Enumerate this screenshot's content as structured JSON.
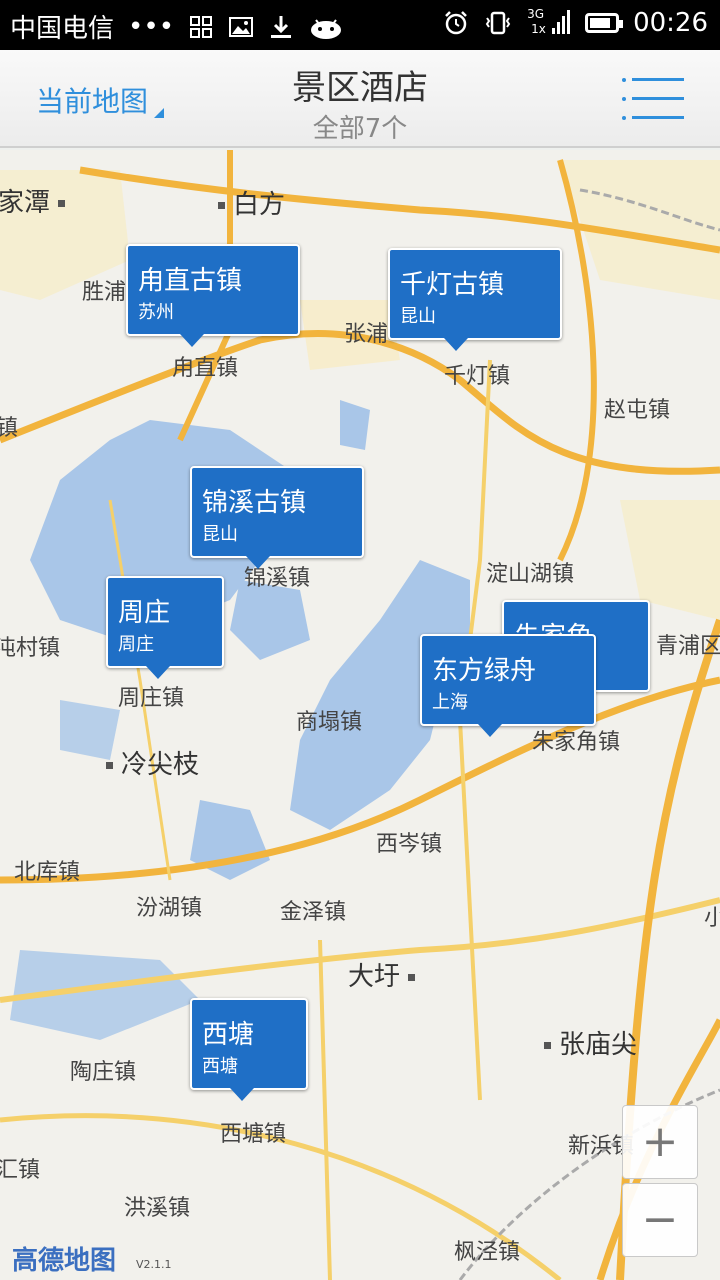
{
  "status_bar": {
    "carrier": "中国电信",
    "dots": "•••",
    "network": "3G",
    "network2": "1x",
    "time": "00:26"
  },
  "header": {
    "map_switch": "当前地图",
    "title": "景区酒店",
    "subtitle": "全部7个"
  },
  "map": {
    "places": [
      {
        "label": "家潭",
        "big": true
      },
      {
        "label": "白方",
        "big": true
      },
      {
        "label": "胜浦"
      },
      {
        "label": "张浦"
      },
      {
        "label": "甪直镇"
      },
      {
        "label": "千灯镇"
      },
      {
        "label": "赵屯镇"
      },
      {
        "label": "镇"
      },
      {
        "label": "锦溪镇"
      },
      {
        "label": "淀山湖镇"
      },
      {
        "label": "青浦区"
      },
      {
        "label": "沌村镇"
      },
      {
        "label": "周庄镇"
      },
      {
        "label": "商塌镇"
      },
      {
        "label": "朱家角镇"
      },
      {
        "label": "冷尖枝",
        "big": true
      },
      {
        "label": "西岑镇"
      },
      {
        "label": "北库镇"
      },
      {
        "label": "汾湖镇"
      },
      {
        "label": "金泽镇"
      },
      {
        "label": "小"
      },
      {
        "label": "大圩",
        "big": true
      },
      {
        "label": "张庙尖",
        "big": true
      },
      {
        "label": "陶庄镇"
      },
      {
        "label": "西塘镇"
      },
      {
        "label": "汇镇"
      },
      {
        "label": "新浜镇"
      },
      {
        "label": "洪溪镇"
      },
      {
        "label": "枫泾镇"
      }
    ],
    "markers": [
      {
        "name": "甪直古镇",
        "city": "苏州"
      },
      {
        "name": "千灯古镇",
        "city": "昆山"
      },
      {
        "name": "锦溪古镇",
        "city": "昆山"
      },
      {
        "name": "周庄",
        "city": "周庄"
      },
      {
        "name": "朱家角",
        "city": ""
      },
      {
        "name": "东方绿舟",
        "city": "上海"
      },
      {
        "name": "西塘",
        "city": "西塘"
      }
    ],
    "zoom_in": "+",
    "zoom_out": "−",
    "logo": "高德地图",
    "version": "V2.1.1"
  }
}
